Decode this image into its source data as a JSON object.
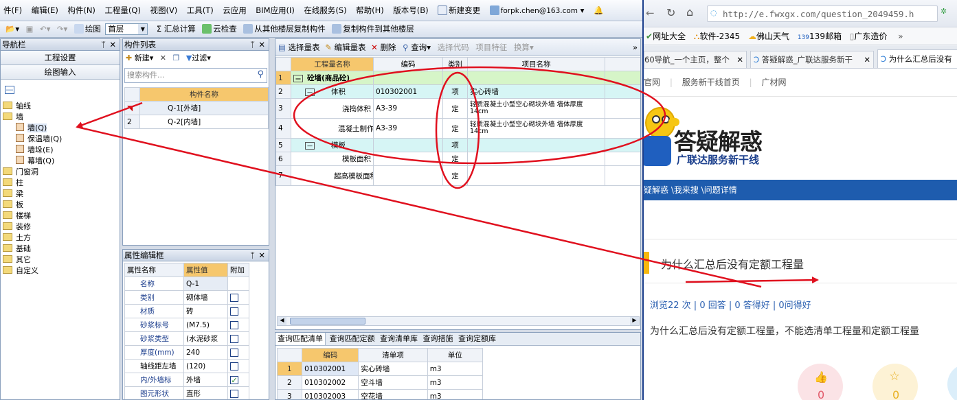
{
  "menu": [
    "件(F)",
    "编辑(E)",
    "构件(N)",
    "工程量(Q)",
    "视图(V)",
    "工具(T)",
    "云应用",
    "BIM应用(I)",
    "在线服务(S)",
    "帮助(H)",
    "版本号(B)",
    "新建变更",
    "forpk.chen@163.com"
  ],
  "toolbar": {
    "draw": "绘图",
    "floor": "首层",
    "sum": "汇总计算",
    "cloud_check": "云检查",
    "copy_from": "从其他楼层复制构件",
    "copy_to": "复制构件到其他楼层"
  },
  "nav": {
    "title": "导航栏",
    "btn1": "工程设置",
    "btn2": "绘图输入",
    "tree": [
      "轴线",
      "墙",
      "墙(Q)",
      "保温墙(Q)",
      "墙垛(E)",
      "幕墙(Q)",
      "门窗洞",
      "柱",
      "梁",
      "板",
      "楼梯",
      "装修",
      "土方",
      "基础",
      "其它",
      "自定义"
    ]
  },
  "component_list": {
    "title": "构件列表",
    "new": "新建",
    "filter": "过滤",
    "search_placeholder": "搜索构件...",
    "header": "构件名称",
    "rows": [
      {
        "n": "1",
        "name": "Q-1[外墙]"
      },
      {
        "n": "2",
        "name": "Q-2[内墙]"
      }
    ]
  },
  "props": {
    "title": "属性编辑框",
    "headers": [
      "属性名称",
      "属性值",
      "附加"
    ],
    "rows": [
      {
        "name": "名称",
        "value": "Q-1"
      },
      {
        "name": "类别",
        "value": "砌体墙"
      },
      {
        "name": "材质",
        "value": "砖"
      },
      {
        "name": "砂浆标号",
        "value": "(M7.5)"
      },
      {
        "name": "砂浆类型",
        "value": "(水泥砂浆"
      },
      {
        "name": "厚度(mm)",
        "value": "240"
      },
      {
        "name": "轴线距左墙",
        "value": "(120)"
      },
      {
        "name": "内/外墙标",
        "value": "外墙"
      },
      {
        "name": "图元形状",
        "value": "直形"
      }
    ]
  },
  "quantity": {
    "toolbar": [
      "选择量表",
      "编辑量表",
      "删除",
      "查询",
      "选择代码",
      "项目特征",
      "换算"
    ],
    "headers": [
      "工程量名称",
      "编码",
      "类别",
      "项目名称"
    ],
    "rows": [
      {
        "n": "1",
        "name": "砼墙(商品砼)",
        "code": "",
        "type": "",
        "proj": ""
      },
      {
        "n": "2",
        "name": "体积",
        "code": "010302001",
        "type": "项",
        "proj": "实心砖墙"
      },
      {
        "n": "3",
        "name": "浇捣体积",
        "code": "A3-39",
        "type": "定",
        "proj": "轻质混凝土小型空心砌块外墙 墙体厚度 14cm"
      },
      {
        "n": "4",
        "name": "混凝土制作",
        "code": "A3-39",
        "type": "定",
        "proj": "轻质混凝土小型空心砌块外墙 墙体厚度 14cm"
      },
      {
        "n": "5",
        "name": "模板",
        "code": "",
        "type": "项",
        "proj": ""
      },
      {
        "n": "6",
        "name": "模板面积",
        "code": "",
        "type": "定",
        "proj": ""
      },
      {
        "n": "7",
        "name": "超高模板面积",
        "code": "",
        "type": "定",
        "proj": ""
      }
    ]
  },
  "query": {
    "tabs": [
      "查询匹配清单",
      "查询匹配定额",
      "查询清单库",
      "查询措施",
      "查询定额库"
    ],
    "headers": [
      "编码",
      "清单项",
      "单位"
    ],
    "rows": [
      {
        "n": "1",
        "code": "010302001",
        "item": "实心砖墙",
        "unit": "m3"
      },
      {
        "n": "2",
        "code": "010302002",
        "item": "空斗墙",
        "unit": "m3"
      },
      {
        "n": "3",
        "code": "010302003",
        "item": "空花墙",
        "unit": "m3"
      }
    ]
  },
  "browser": {
    "url": "http://e.fwxgx.com/question_2049459.h",
    "bookmarks": [
      "网址大全",
      "软件-2345",
      "佛山天气",
      "139邮箱",
      "广东造价"
    ],
    "tabs": [
      "60导航_一个主页，整个",
      "答疑解惑_广联达服务新干",
      "为什么汇总后没有"
    ],
    "nav_links": [
      "官网",
      "服务新干线首页",
      "广材网"
    ],
    "logo_title": "答疑解惑",
    "logo_sub": "广联达服务新干线",
    "crumb": "疑解惑 \\我来搜 \\问题详情",
    "question_title": "为什么汇总后没有定额工程量",
    "stats": "浏览22 次 | 0 回答 | 0 答得好 | 0问得好",
    "question_body": "为什么汇总后没有定额工程量，不能选清单工程量和定额工程量",
    "likes": "0",
    "stars": "0"
  }
}
